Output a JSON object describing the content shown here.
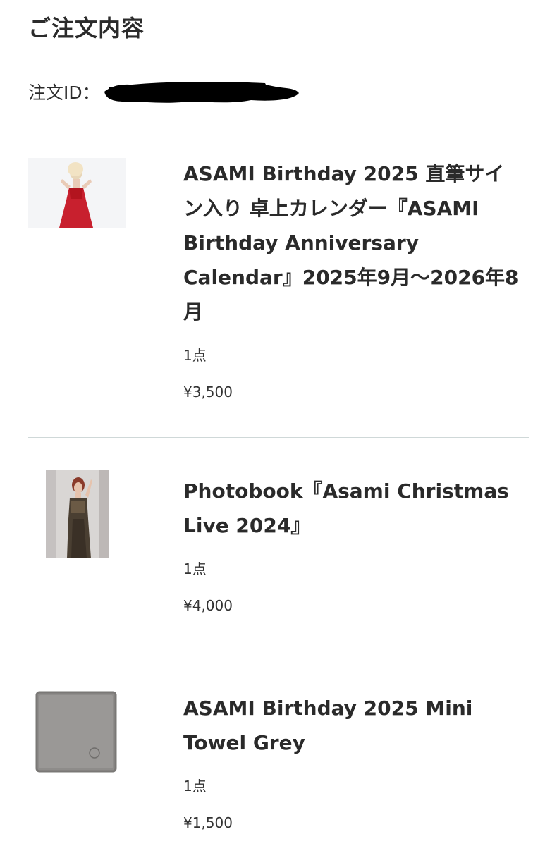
{
  "section_title": "ご注文内容",
  "order_id_label": "注文ID：",
  "order_id_value_redacted": true,
  "items": [
    {
      "thumbnail_icon": "calendar-photo-thumbnail",
      "title": "ASAMI Birthday 2025 直筆サイン入り 卓上カレンダー『ASAMI Birthday Anniversary Calendar』2025年9月〜2026年8月",
      "quantity": "1点",
      "price": "¥3,500"
    },
    {
      "thumbnail_icon": "photobook-thumbnail",
      "title": "Photobook『Asami Christmas Live 2024』",
      "quantity": "1点",
      "price": "¥4,000"
    },
    {
      "thumbnail_icon": "mini-towel-thumbnail",
      "title": "ASAMI Birthday 2025 Mini Towel Grey",
      "quantity": "1点",
      "price": "¥1,500"
    }
  ],
  "colors": {
    "text": "#2b2b2b",
    "divider": "#cfd8d8",
    "redaction": "#000000"
  }
}
